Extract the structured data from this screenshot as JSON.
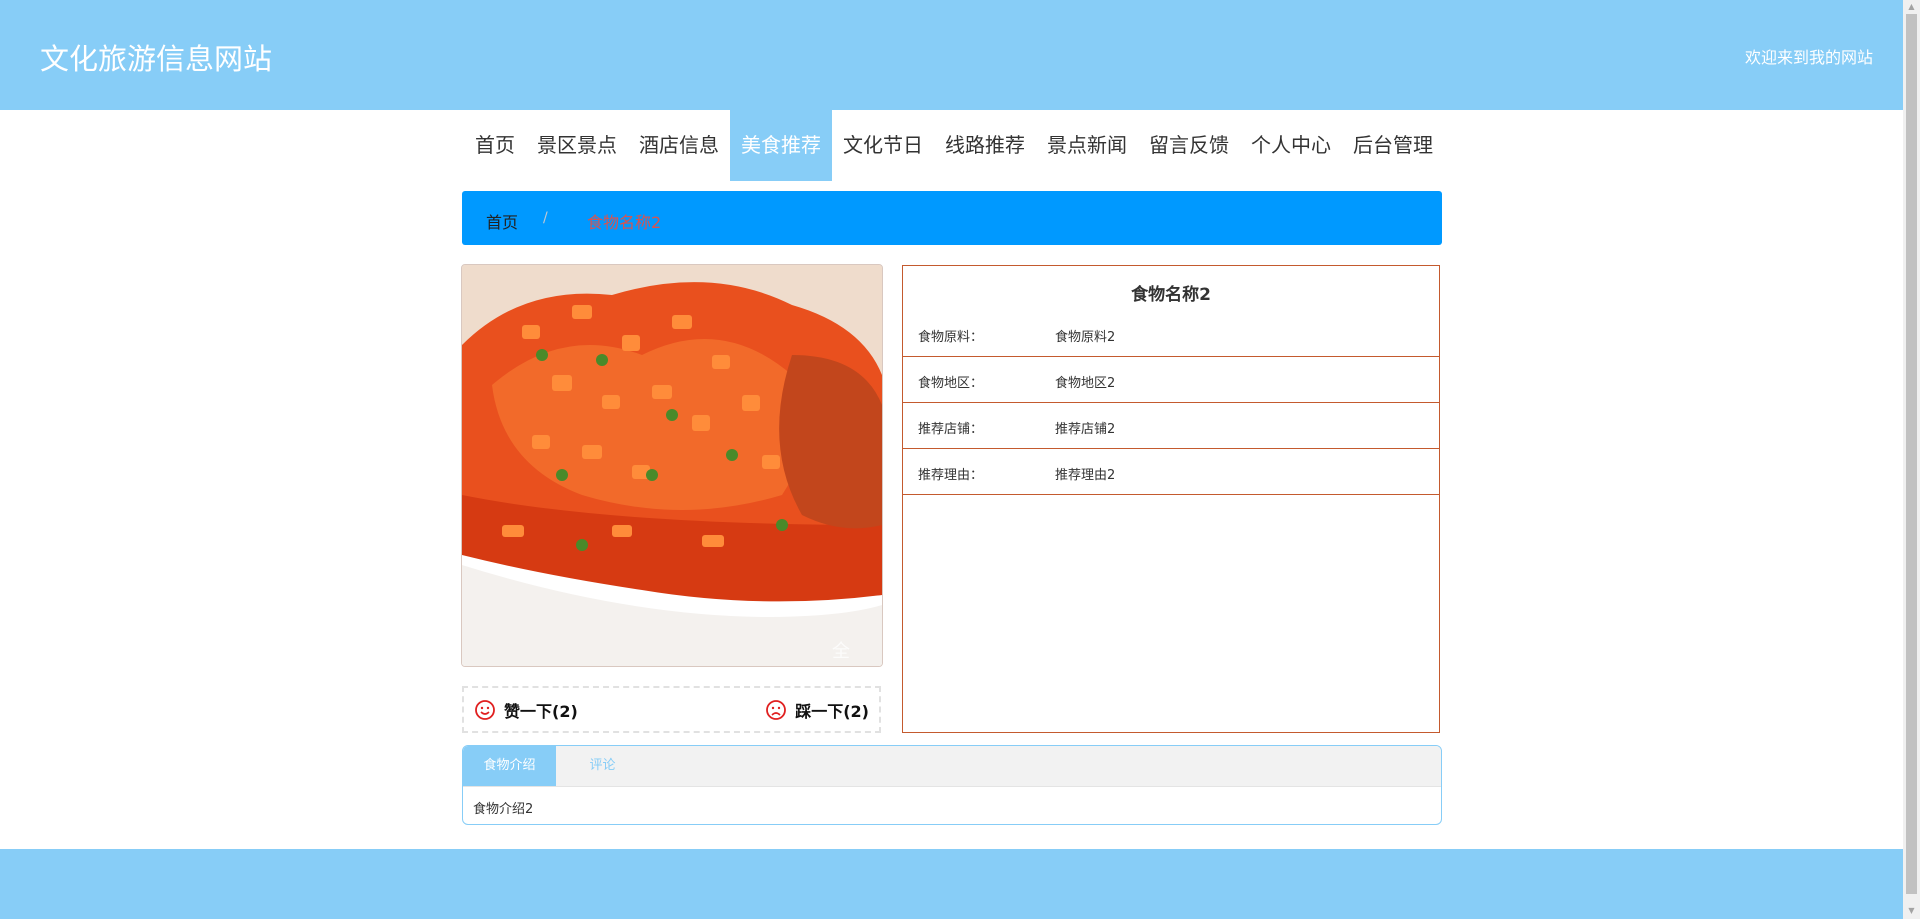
{
  "header": {
    "title": "文化旅游信息网站",
    "welcome": "欢迎来到我的网站"
  },
  "nav": {
    "items": [
      {
        "label": "首页"
      },
      {
        "label": "景区景点"
      },
      {
        "label": "酒店信息"
      },
      {
        "label": "美食推荐",
        "active": true
      },
      {
        "label": "文化节日"
      },
      {
        "label": "线路推荐"
      },
      {
        "label": "景点新闻"
      },
      {
        "label": "留言反馈"
      },
      {
        "label": "个人中心"
      },
      {
        "label": "后台管理"
      }
    ]
  },
  "breadcrumb": {
    "home": "首页",
    "separator": "/",
    "current": "食物名称2"
  },
  "photo": {
    "watermark": "全"
  },
  "vote": {
    "like_label": "赞一下(2)",
    "dislike_label": "踩一下(2)"
  },
  "detail": {
    "title": "食物名称2",
    "rows": [
      {
        "key": "食物原料：",
        "value": "食物原料2"
      },
      {
        "key": "食物地区：",
        "value": "食物地区2"
      },
      {
        "key": "推荐店铺：",
        "value": "推荐店铺2"
      },
      {
        "key": "推荐理由：",
        "value": "推荐理由2"
      }
    ]
  },
  "tabs": {
    "intro_label": "食物介绍",
    "comment_label": "评论",
    "intro_content": "食物介绍2"
  },
  "colors": {
    "header_bg": "#87cdf7",
    "breadcrumb_bg": "#0099ff",
    "detail_border": "#c45a2e",
    "vote_icon": "#e02020"
  }
}
